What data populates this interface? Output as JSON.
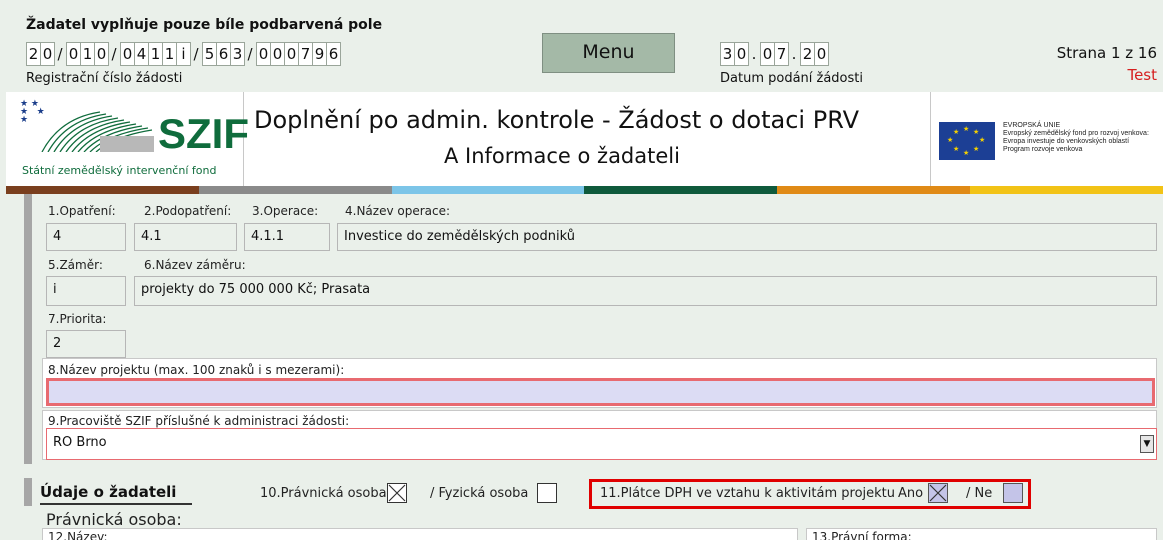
{
  "header": {
    "note": "Žadatel vyplňuje pouze bíle podbarvená pole",
    "reg_groups": [
      [
        "2",
        "0"
      ],
      [
        "0",
        "1",
        "0"
      ],
      [
        "0",
        "4",
        "1",
        "1",
        "i"
      ],
      [
        "5",
        "6",
        "3"
      ],
      [
        "0",
        "0",
        "0",
        "7",
        "9",
        "6"
      ]
    ],
    "reg_caption": "Registrační číslo žádosti",
    "menu_label": "Menu",
    "date_groups": [
      [
        "3",
        "0"
      ],
      [
        "0",
        "7"
      ],
      [
        "2",
        "0"
      ]
    ],
    "date_caption": "Datum podání žádosti",
    "page": "Strana 1 z 16",
    "mode": "Test"
  },
  "banner": {
    "logo_text": "SZIF",
    "logo_subtitle": "Státní zemědělský intervenční fond",
    "title_line1": "Doplnění po admin. kontrole - Žádost o dotaci PRV",
    "title_line2": "A Informace o žadateli",
    "eu_lines": [
      "EVROPSKÁ UNIE",
      "Evropský zemědělský fond pro rozvoj venkova:",
      "Evropa investuje do venkovských oblastí",
      "Program rozvoje venkova"
    ],
    "colors": [
      "#7a3f1e",
      "#8a8a8a",
      "#7cc5e8",
      "#0f5a3c",
      "#e08a16",
      "#f2c316"
    ]
  },
  "fields": {
    "opatreni_label": "1.Opatření:",
    "opatreni_value": "4",
    "podopatreni_label": "2.Podopatření:",
    "podopatreni_value": "4.1",
    "operace_label": "3.Operace:",
    "operace_value": "4.1.1",
    "nazev_operace_label": "4.Název operace:",
    "nazev_operace_value": "Investice do zemědělských podniků",
    "zamer_label": "5.Záměr:",
    "zamer_value": "i",
    "nazev_zameru_label": "6.Název záměru:",
    "nazev_zameru_value": "projekty do 75 000 000 Kč; Prasata",
    "priorita_label": "7.Priorita:",
    "priorita_value": "2",
    "nazev_projektu_label": "8.Název projektu (max. 100 znaků i s mezerami):",
    "nazev_projektu_value": "",
    "pracoviste_label": "9.Pracoviště SZIF příslušné k administraci žádosti:",
    "pracoviste_value": "RO Brno"
  },
  "applicant": {
    "section_title": "Údaje o žadateli",
    "pravnicka_label": "10.Právnická osoba",
    "pravnicka_checked": true,
    "fyzicka_label": "/ Fyzická osoba",
    "fyzicka_checked": false,
    "dph_label": "11.Plátce DPH ve vztahu k aktivitám projektu",
    "ano_label": "Ano",
    "ano_checked": true,
    "ne_label": "/ Ne",
    "ne_checked": false,
    "subsection": "Právnická osoba:",
    "nazev_label": "12.Název:",
    "pravni_forma_label": "13.Právní forma:"
  }
}
